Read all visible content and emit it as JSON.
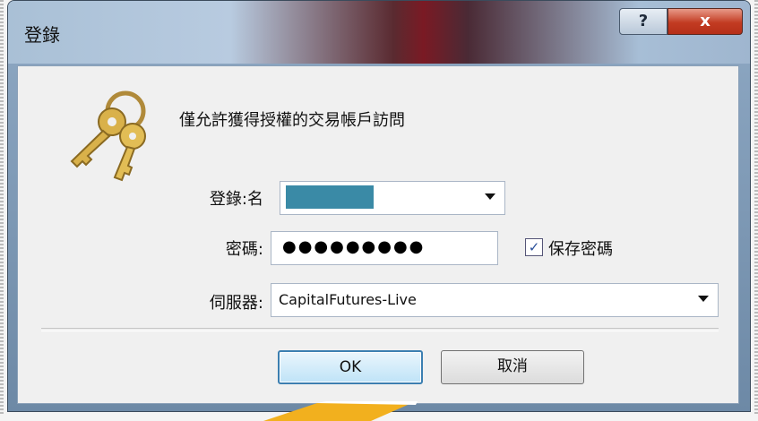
{
  "window": {
    "title": "登錄"
  },
  "titlebar": {
    "help_label": "?",
    "close_label": "x"
  },
  "message": "僅允許獲得授權的交易帳戶訪問",
  "form": {
    "login_label": "登錄:名",
    "password_label": "密碼:",
    "password_value": "●●●●●●●●●",
    "save_password_label": "保存密碼",
    "save_password_checked": true,
    "server_label": "伺服器:",
    "server_value": "CapitalFutures-Live"
  },
  "buttons": {
    "ok": "OK",
    "cancel": "取消"
  },
  "colors": {
    "redaction": "#3a8aa6",
    "callout": "#f2b01e"
  }
}
